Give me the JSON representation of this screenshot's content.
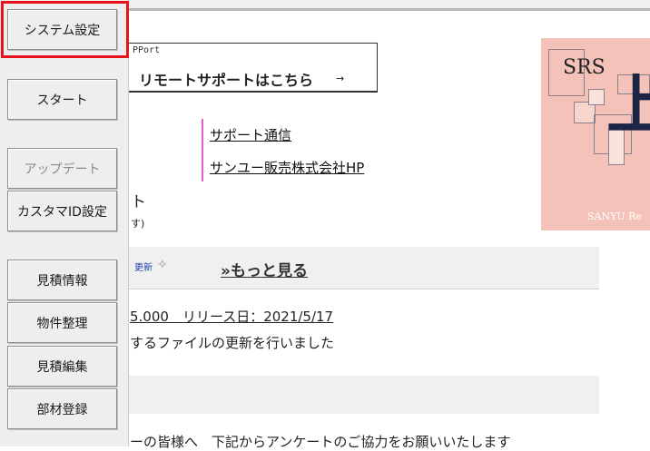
{
  "sidebar": {
    "buttons": [
      {
        "label": "システム設定"
      },
      {
        "label": "スタート"
      },
      {
        "label": "アップデート"
      },
      {
        "label": "カスタマID設定"
      },
      {
        "label": "見積情報"
      },
      {
        "label": "物件整理"
      },
      {
        "label": "見積編集"
      },
      {
        "label": "部材登録"
      }
    ]
  },
  "remote_support": {
    "small_label": "PPort",
    "title": "リモートサポートはこちら",
    "arrow": "→"
  },
  "links": {
    "support_news": "サポート通信",
    "company_hp": "サンユー販売株式会社HP"
  },
  "fragments": {
    "char_a": "ト",
    "char_b": "す)"
  },
  "banner": {
    "srs": "SRS",
    "kanji": "上",
    "caption": "SANYU Re"
  },
  "news": {
    "update_label": "更新",
    "sparkle": "✧",
    "more_link": "»もっと見る",
    "version_line": "5.000　リリース日：2021/5/17",
    "desc_line": "するファイルの更新を行いました",
    "survey_line": "ーの皆様へ　下記からアンケートのご協力をお願いいたします"
  },
  "colors": {
    "highlight": "#e8141b",
    "pink_bar": "#e35cc8",
    "update_blue": "#1f3ea8",
    "banner_bg": "#f4c2b8",
    "banner_kanji": "#1c2545"
  }
}
